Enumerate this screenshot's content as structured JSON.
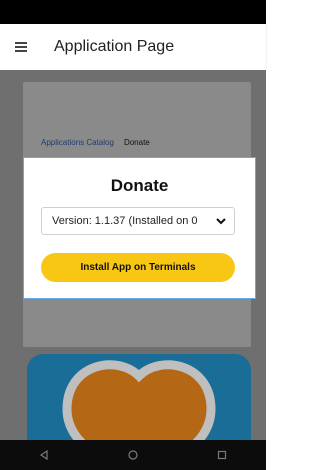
{
  "app_bar": {
    "title": "Application Page",
    "menu_icon": "hamburger-menu-icon"
  },
  "breadcrumb": {
    "items": [
      "Applications Catalog",
      "Donate"
    ]
  },
  "modal": {
    "title": "Donate",
    "version_select": {
      "selected": "Version: 1.1.37 (Installed on 0",
      "icon": "chevron-down-icon"
    },
    "install_button_label": "Install App on Terminals"
  },
  "colors": {
    "accent_button": "#f7c713",
    "modal_border": "#69a7e6",
    "app_icon_bg": "#2292c8",
    "heart": "#f08a1c"
  },
  "nav": {
    "icons": [
      "back-icon",
      "home-icon",
      "recents-icon"
    ]
  }
}
